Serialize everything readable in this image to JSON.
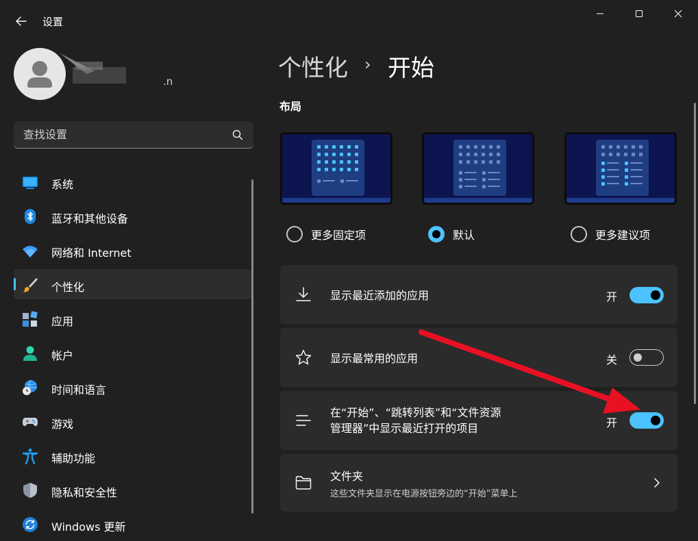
{
  "window": {
    "title": "设置",
    "controls": [
      "minimize",
      "maximize",
      "close"
    ]
  },
  "profile": {
    "email_fragment": ".n"
  },
  "search": {
    "placeholder": "查找设置"
  },
  "sidebar": {
    "items": [
      {
        "label": "系统",
        "icon": "display-icon",
        "active": false
      },
      {
        "label": "蓝牙和其他设备",
        "icon": "bluetooth-icon",
        "active": false
      },
      {
        "label": "网络和 Internet",
        "icon": "wifi-icon",
        "active": false
      },
      {
        "label": "个性化",
        "icon": "paintbrush-icon",
        "active": true
      },
      {
        "label": "应用",
        "icon": "apps-icon",
        "active": false
      },
      {
        "label": "帐户",
        "icon": "account-icon",
        "active": false
      },
      {
        "label": "时间和语言",
        "icon": "globe-clock-icon",
        "active": false
      },
      {
        "label": "游戏",
        "icon": "gamepad-icon",
        "active": false
      },
      {
        "label": "辅助功能",
        "icon": "accessibility-icon",
        "active": false
      },
      {
        "label": "隐私和安全性",
        "icon": "shield-icon",
        "active": false
      },
      {
        "label": "Windows 更新",
        "icon": "update-icon",
        "active": false
      }
    ]
  },
  "breadcrumb": {
    "parent": "个性化",
    "separator": "›",
    "current": "开始"
  },
  "layout": {
    "title": "布局",
    "options": [
      {
        "label": "更多固定项",
        "selected": false
      },
      {
        "label": "默认",
        "selected": true
      },
      {
        "label": "更多建议项",
        "selected": false
      }
    ]
  },
  "settings": [
    {
      "label": "显示最近添加的应用",
      "icon": "download-icon",
      "state_label": "开",
      "on": true
    },
    {
      "label": "显示最常用的应用",
      "icon": "star-icon",
      "state_label": "关",
      "on": false
    },
    {
      "label_line1": "在“开始”、“跳转列表”和“文件资源",
      "label_line2": "管理器”中显示最近打开的项目",
      "icon": "list-icon",
      "state_label": "开",
      "on": true
    },
    {
      "label": "文件夹",
      "sub": "这些文件夹显示在电源按钮旁边的“开始”菜单上",
      "icon": "folder-icon"
    }
  ],
  "colors": {
    "background": "#202020",
    "card": "#2b2b2b",
    "accent": "#4cc2ff",
    "annotation_arrow": "#e81123"
  }
}
